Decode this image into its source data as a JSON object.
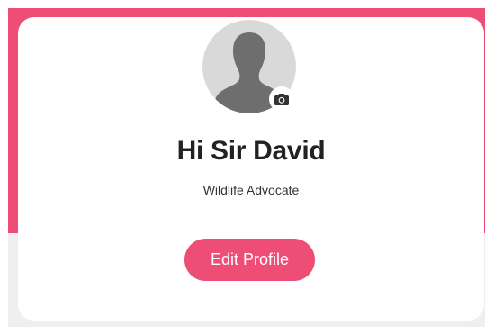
{
  "profile": {
    "greeting": "Hi Sir David",
    "subtitle": "Wildlife Advocate",
    "edit_button_label": "Edit Profile",
    "avatar_icon": "person-silhouette-icon",
    "camera_icon": "camera-icon"
  },
  "colors": {
    "accent": "#ee4e76",
    "card_background": "#ffffff",
    "page_background": "#efefef",
    "avatar_background": "#d9d9d9",
    "avatar_silhouette": "#6e6e6e",
    "text_primary": "#222222"
  }
}
